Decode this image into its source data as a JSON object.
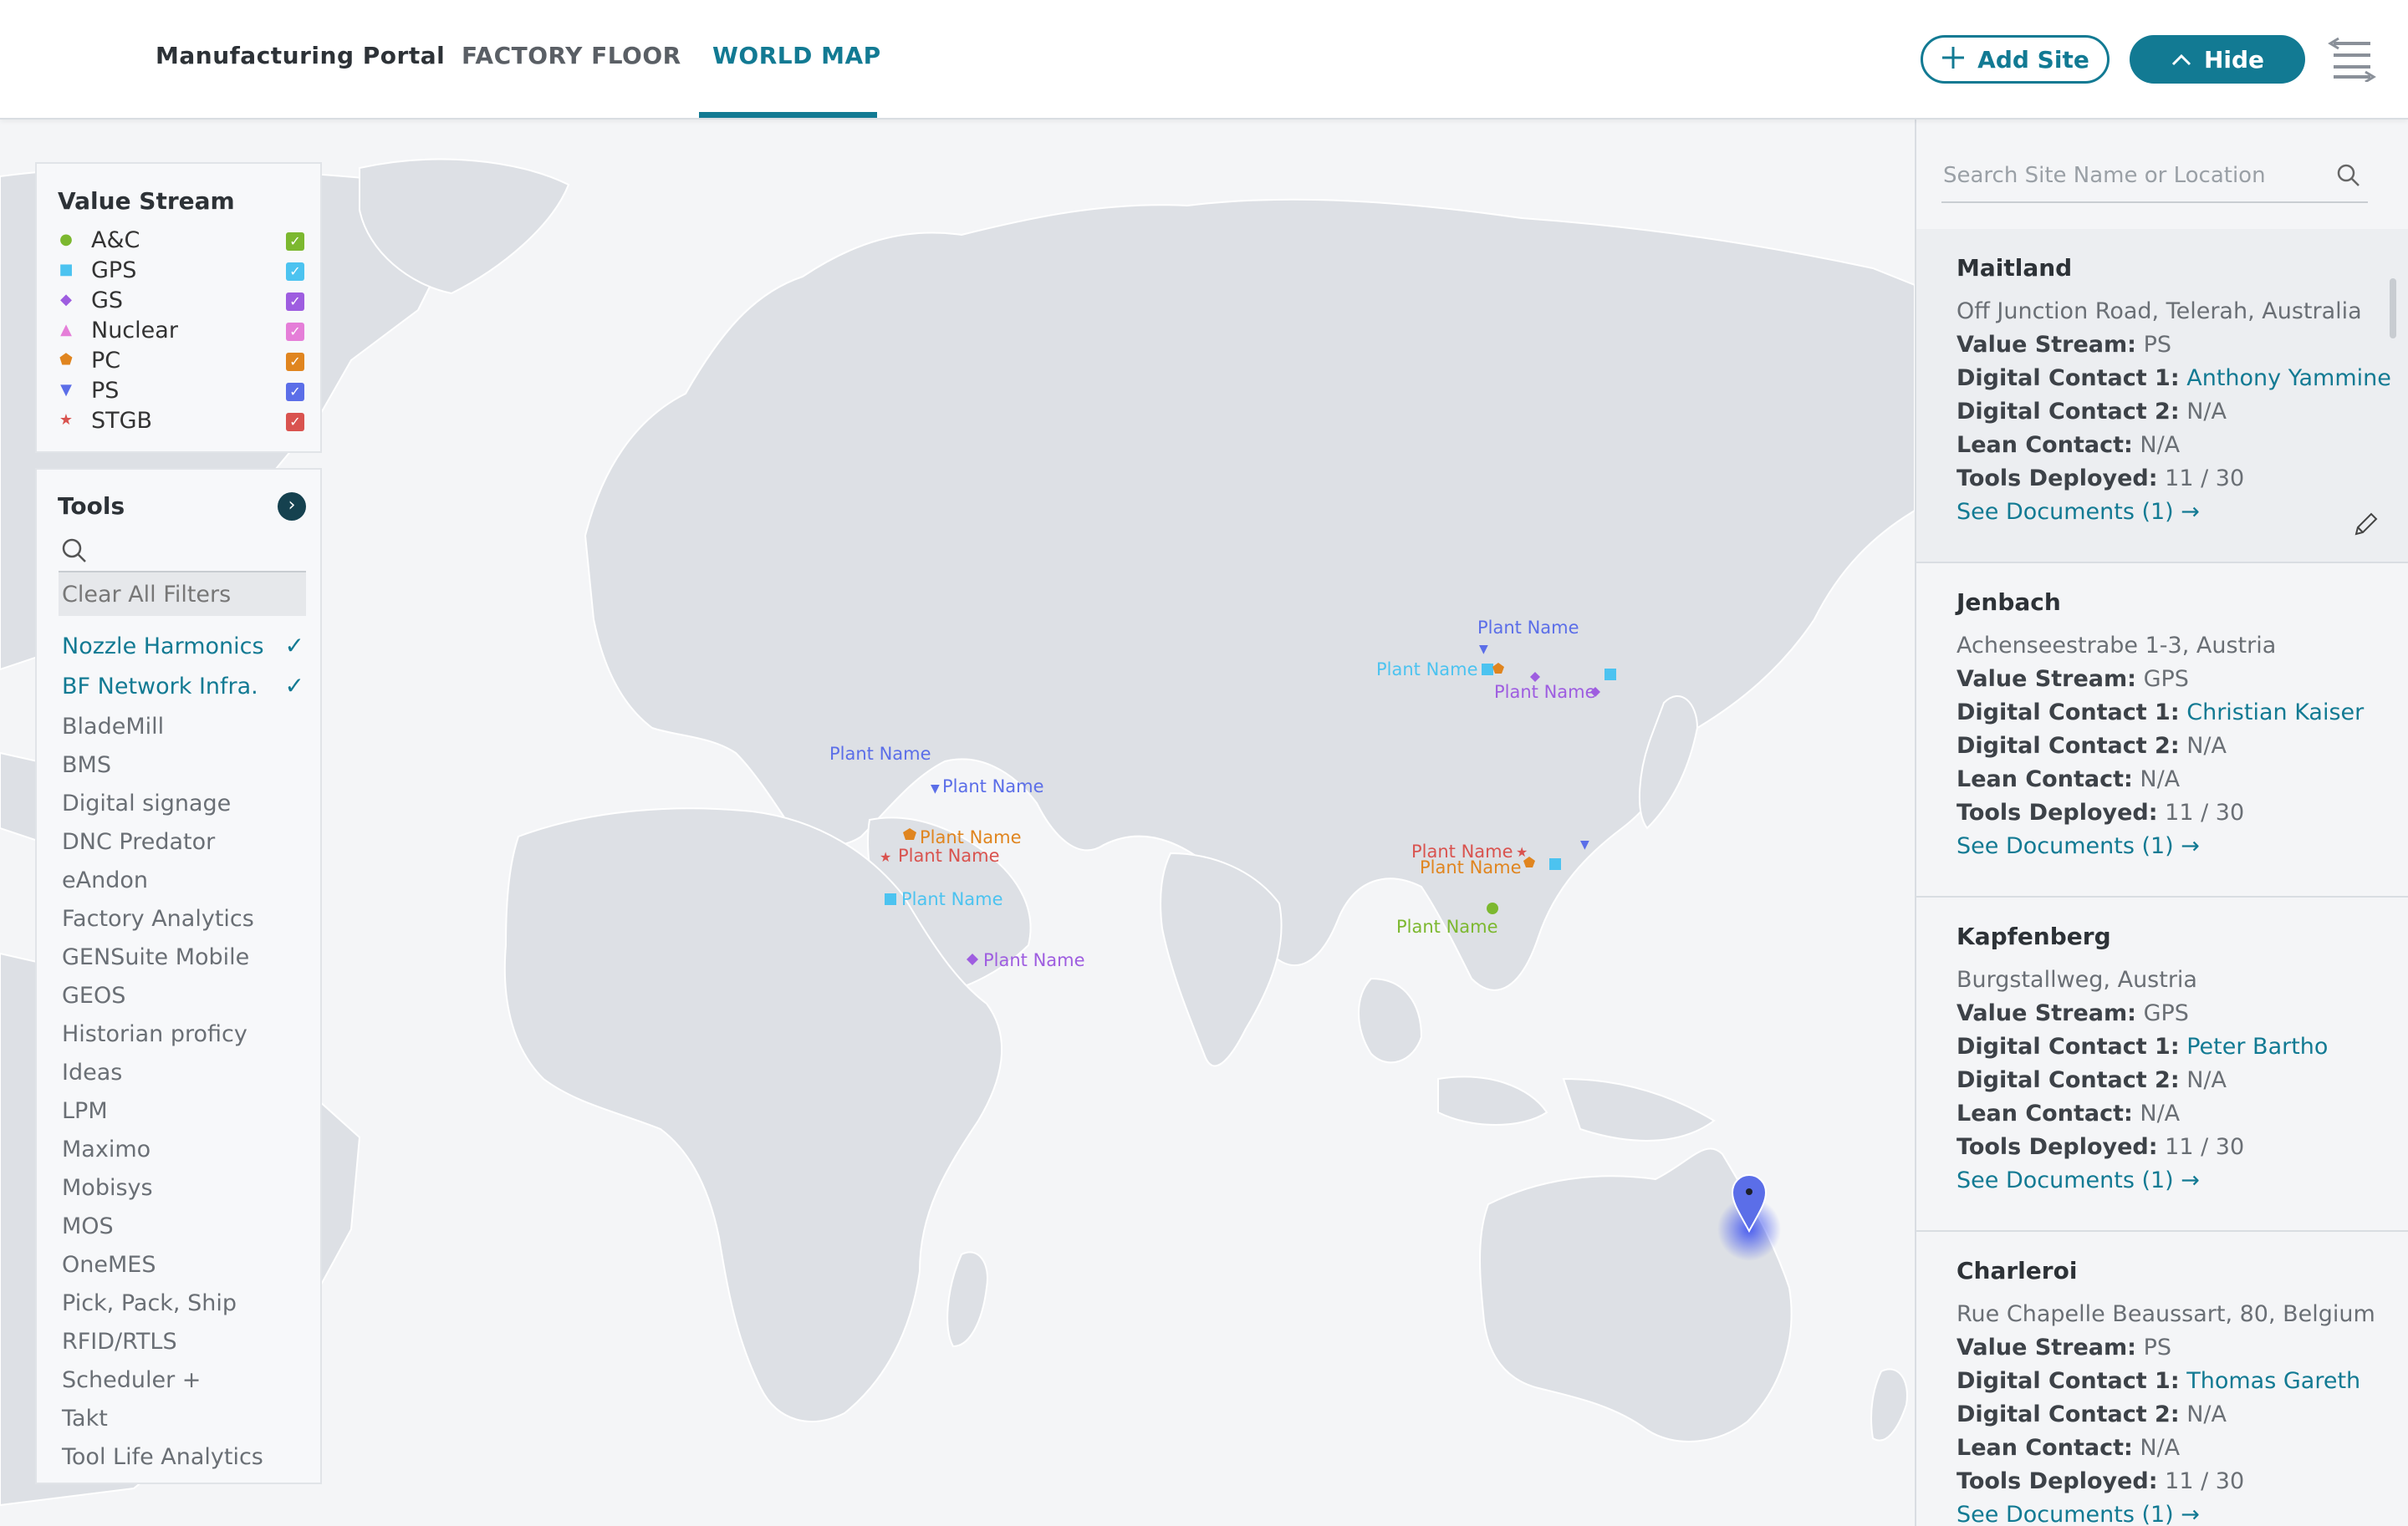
{
  "header": {
    "brand": "Manufacturing Portal",
    "tabs": [
      {
        "label": "FACTORY FLOOR",
        "active": false
      },
      {
        "label": "WORLD MAP",
        "active": true
      }
    ],
    "add_site_label": "Add Site",
    "hide_label": "Hide",
    "add_site_icon": "plus-icon",
    "hide_icon": "chevron-up-icon",
    "menu_icon": "filter-menu-icon"
  },
  "colors": {
    "accent": "#127a93",
    "ac": "#7cb82f",
    "gps": "#4cc3f0",
    "gs": "#9e5de0",
    "nuclear": "#e57ed8",
    "pc": "#e0851f",
    "ps": "#5b6ee8",
    "stgb": "#d9534f"
  },
  "value_stream": {
    "title": "Value Stream",
    "items": [
      {
        "label": "A&C",
        "marker": "●",
        "color": "#7cb82f",
        "checked": true
      },
      {
        "label": "GPS",
        "marker": "■",
        "color": "#4cc3f0",
        "checked": true
      },
      {
        "label": "GS",
        "marker": "◆",
        "color": "#9e5de0",
        "checked": true
      },
      {
        "label": "Nuclear",
        "marker": "▲",
        "color": "#e57ed8",
        "checked": true
      },
      {
        "label": "PC",
        "marker": "⬟",
        "color": "#e0851f",
        "checked": true
      },
      {
        "label": "PS",
        "marker": "▼",
        "color": "#5b6ee8",
        "checked": true
      },
      {
        "label": "STGB",
        "marker": "★",
        "color": "#d9534f",
        "checked": true
      }
    ]
  },
  "tools": {
    "title": "Tools",
    "clear_label": "Clear All Filters",
    "items": [
      {
        "label": "Nozzle Harmonics",
        "selected": true
      },
      {
        "label": "BF Network Infra.",
        "selected": true
      },
      {
        "label": "BladeMill",
        "selected": false
      },
      {
        "label": "BMS",
        "selected": false
      },
      {
        "label": "Digital signage",
        "selected": false
      },
      {
        "label": "DNC Predator",
        "selected": false
      },
      {
        "label": "eAndon",
        "selected": false
      },
      {
        "label": "Factory Analytics",
        "selected": false
      },
      {
        "label": "GENSuite Mobile",
        "selected": false
      },
      {
        "label": "GEOS",
        "selected": false
      },
      {
        "label": "Historian proficy",
        "selected": false
      },
      {
        "label": "Ideas",
        "selected": false
      },
      {
        "label": "LPM",
        "selected": false
      },
      {
        "label": "Maximo",
        "selected": false
      },
      {
        "label": "Mobisys",
        "selected": false
      },
      {
        "label": "MOS",
        "selected": false
      },
      {
        "label": "OneMES",
        "selected": false
      },
      {
        "label": "Pick, Pack, Ship",
        "selected": false
      },
      {
        "label": "RFID/RTLS",
        "selected": false
      },
      {
        "label": "Scheduler +",
        "selected": false
      },
      {
        "label": "Takt",
        "selected": false
      },
      {
        "label": "Tool Life Analytics",
        "selected": false
      }
    ]
  },
  "map": {
    "plant_label": "Plant Name",
    "markers": [
      {
        "stream": "ps",
        "label": "Plant Name"
      },
      {
        "stream": "ps",
        "label": "Plant Name"
      },
      {
        "stream": "pc",
        "label": "Plant Name"
      },
      {
        "stream": "stgb",
        "label": "Plant Name"
      },
      {
        "stream": "gps",
        "label": "Plant Name"
      },
      {
        "stream": "gs",
        "label": "Plant Name"
      },
      {
        "stream": "ps",
        "label": "Plant Name"
      },
      {
        "stream": "gps",
        "label": "Plant Name"
      },
      {
        "stream": "gs",
        "label": "Plant Name"
      },
      {
        "stream": "stgb",
        "label": "Plant Name"
      },
      {
        "stream": "pc",
        "label": "Plant Name"
      },
      {
        "stream": "ac",
        "label": "Plant Name"
      }
    ]
  },
  "sidebar": {
    "search_placeholder": "Search Site Name or Location",
    "labels": {
      "value_stream": "Value Stream:",
      "digital_contact_1": "Digital Contact 1:",
      "digital_contact_2": "Digital Contact 2:",
      "lean_contact": "Lean Contact:",
      "tools_deployed": "Tools Deployed:"
    },
    "sites": [
      {
        "name": "Maitland",
        "address": "Off Junction Road, Telerah, Australia",
        "value_stream": "PS",
        "digital_contact_1": "Anthony Yammine",
        "digital_contact_2": "N/A",
        "lean_contact": "N/A",
        "tools_deployed": "11 / 30",
        "documents": "See Documents (1) →"
      },
      {
        "name": "Jenbach",
        "address": "Achenseestrabe 1-3, Austria",
        "value_stream": "GPS",
        "digital_contact_1": "Christian Kaiser",
        "digital_contact_2": "N/A",
        "lean_contact": "N/A",
        "tools_deployed": "11 / 30",
        "documents": "See Documents (1) →"
      },
      {
        "name": "Kapfenberg",
        "address": "Burgstallweg, Austria",
        "value_stream": "GPS",
        "digital_contact_1": "Peter Bartho",
        "digital_contact_2": "N/A",
        "lean_contact": "N/A",
        "tools_deployed": "11 / 30",
        "documents": "See Documents (1) →"
      },
      {
        "name": "Charleroi",
        "address": "Rue Chapelle Beaussart, 80, Belgium",
        "value_stream": "PS",
        "digital_contact_1": "Thomas Gareth",
        "digital_contact_2": "N/A",
        "lean_contact": "N/A",
        "tools_deployed": "11 / 30",
        "documents": "See Documents (1) →"
      }
    ]
  }
}
